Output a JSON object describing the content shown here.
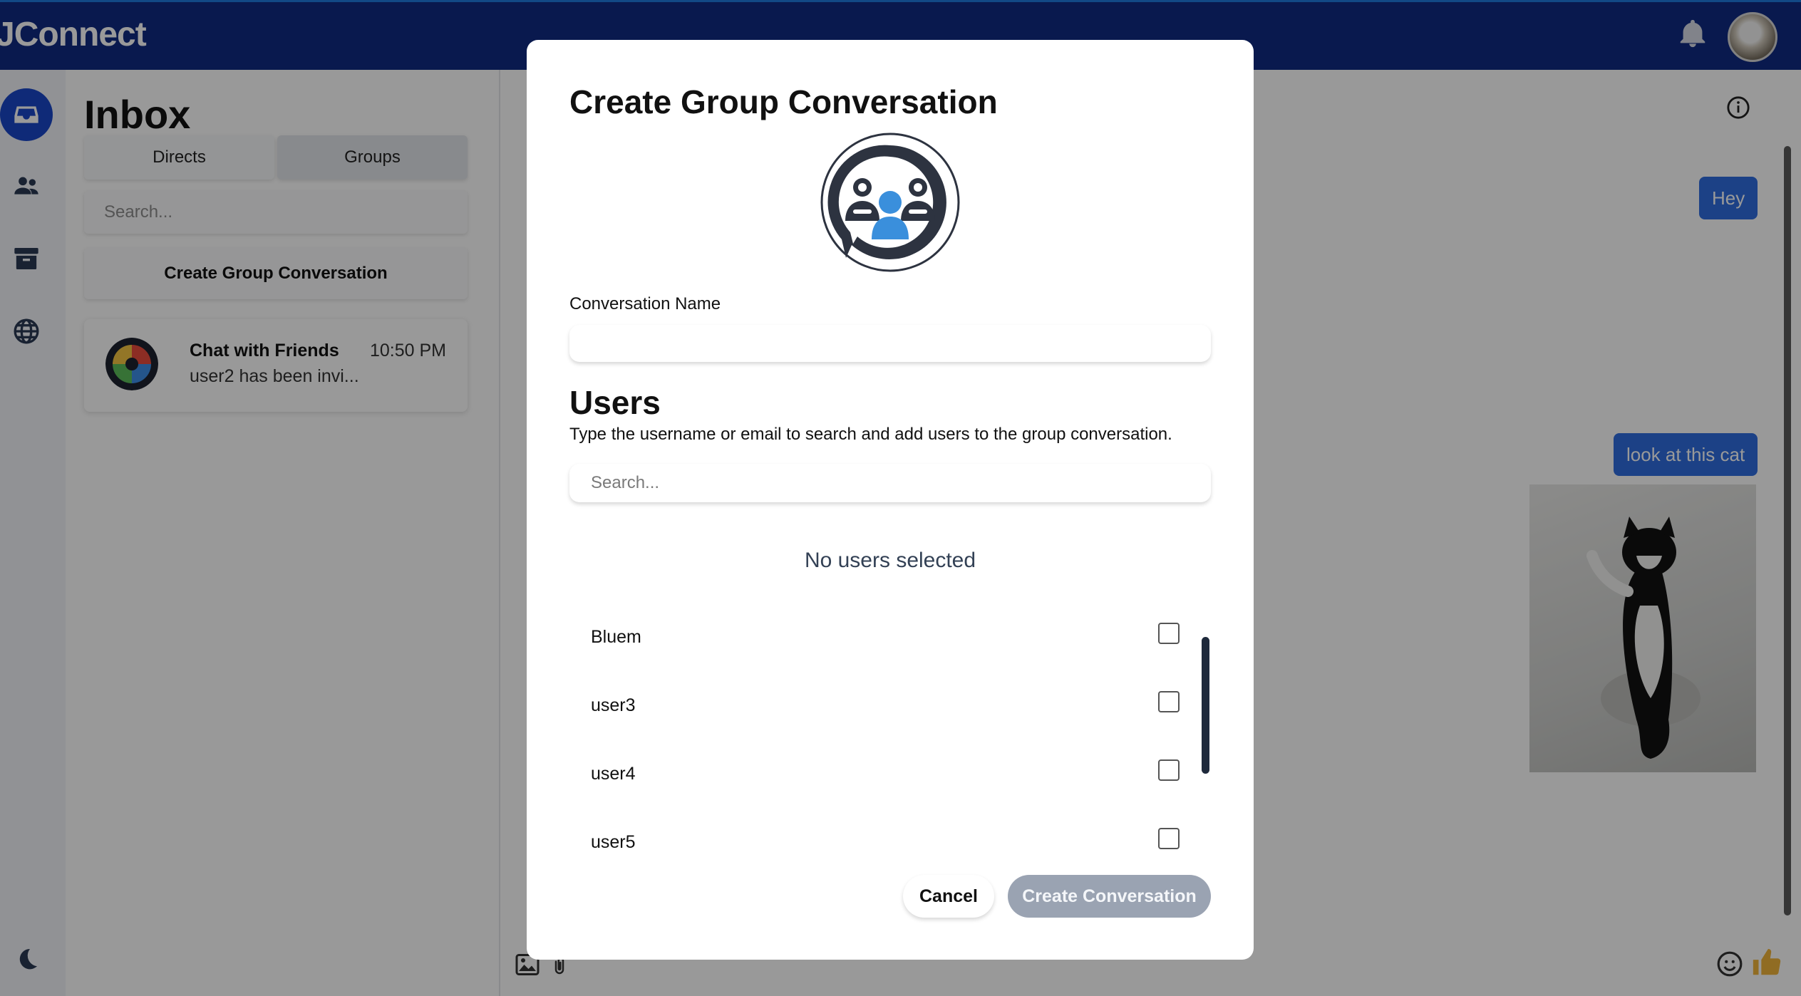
{
  "app": {
    "brand": "JConnect"
  },
  "header": {
    "notification_icon": "bell-icon",
    "profile_icon": "avatar"
  },
  "rail": {
    "items": [
      {
        "icon": "inbox-icon",
        "active": true
      },
      {
        "icon": "users-icon",
        "active": false
      },
      {
        "icon": "archive-icon",
        "active": false
      },
      {
        "icon": "globe-icon",
        "active": false
      }
    ],
    "theme_icon": "moon-icon"
  },
  "inbox": {
    "title": "Inbox",
    "tabs": [
      {
        "label": "Directs",
        "selected": false
      },
      {
        "label": "Groups",
        "selected": true
      }
    ],
    "search_placeholder": "Search...",
    "create_button": "Create Group Conversation",
    "conversations": [
      {
        "name": "Chat with Friends",
        "time": "10:50 PM",
        "preview": "user2 has been invi..."
      }
    ]
  },
  "chat": {
    "messages": [
      {
        "text": "Hey"
      },
      {
        "text": "look at this cat"
      }
    ],
    "attachment_image": "cat-photo",
    "accent_color": "#2f6de0"
  },
  "modal": {
    "title": "Create Group Conversation",
    "name_label": "Conversation Name",
    "name_value": "",
    "users_title": "Users",
    "users_description": "Type the username or email to search and add users to the group conversation.",
    "user_search_placeholder": "Search...",
    "no_users_text": "No users selected",
    "users": [
      {
        "name": "Bluem",
        "checked": false
      },
      {
        "name": "user3",
        "checked": false
      },
      {
        "name": "user4",
        "checked": false
      },
      {
        "name": "user5",
        "checked": false
      }
    ],
    "cancel_label": "Cancel",
    "create_label": "Create Conversation",
    "create_disabled_color": "#9aa3b2"
  }
}
